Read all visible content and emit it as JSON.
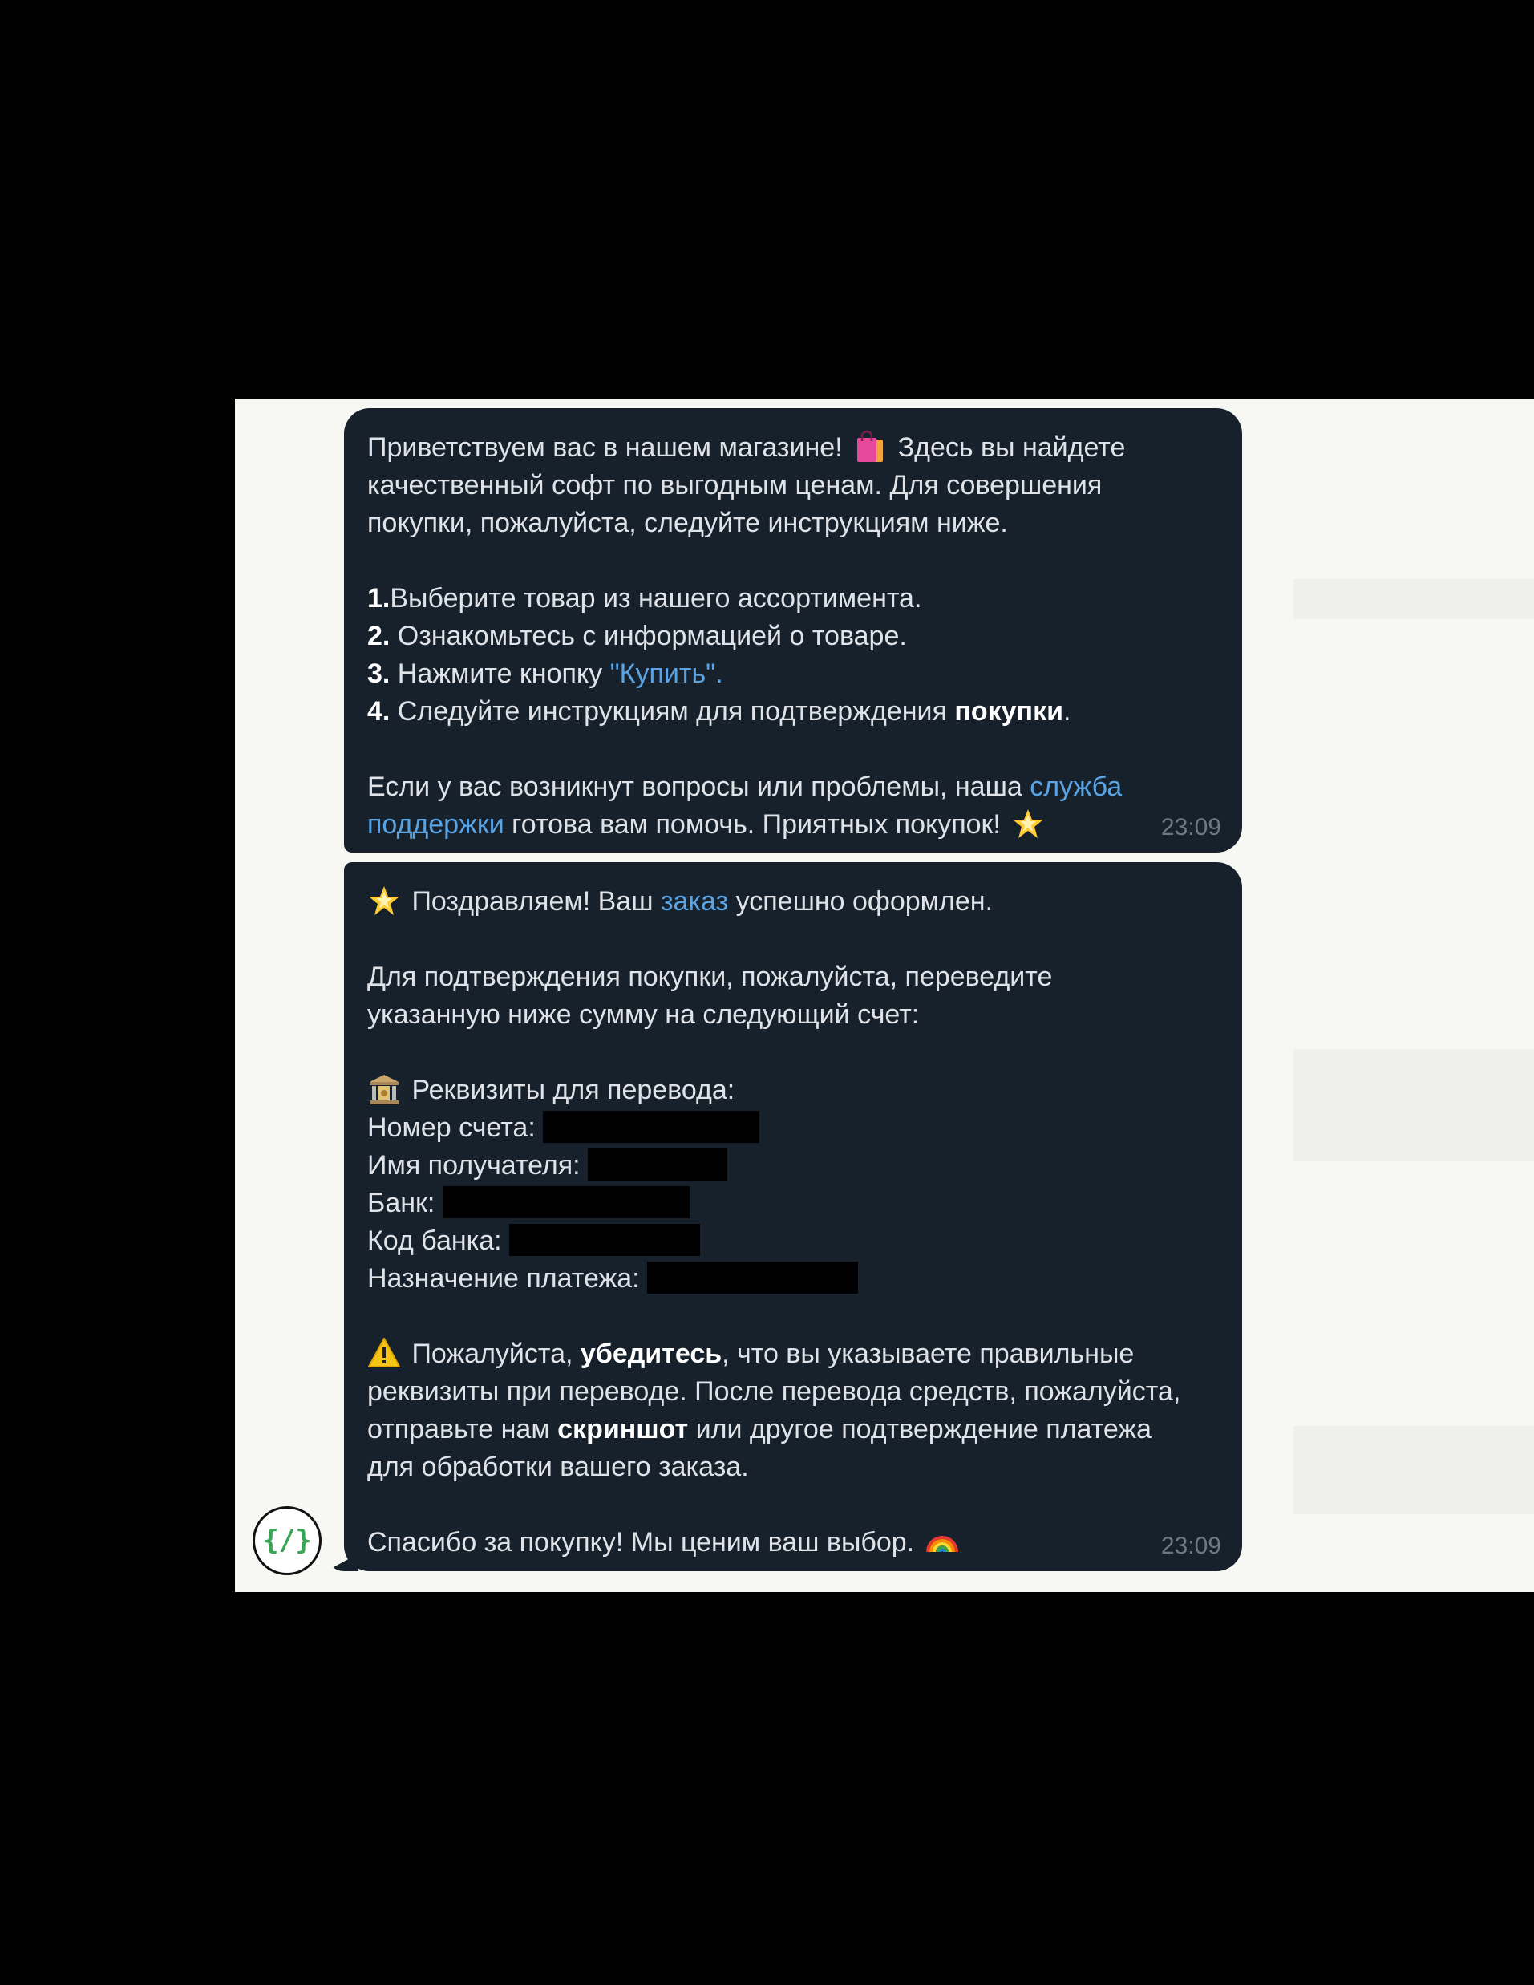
{
  "messages": [
    {
      "lines": {
        "l1a": "Приветствуем вас в нашем магазине!",
        "l1b": "Здесь вы найдете",
        "l2": "качественный софт по выгодным ценам. Для совершения",
        "l3": "покупки, пожалуйста, следуйте инструкциям ниже.",
        "step1_num": "1.",
        "step1_text": "Выберите товар из нашего ассортимента.",
        "step2_num": "2.",
        "step2_text": " Ознакомьтесь с информацией о товаре.",
        "step3_num": "3.",
        "step3_text": " Нажмите кнопку ",
        "step3_link": "\"Купить\".",
        "step4_num": "4.",
        "step4_text": " Следуйте инструкциям для подтверждения ",
        "step4_bold": "покупки",
        "step4_end": ".",
        "help_a": "Если у вас возникнут вопросы или проблемы, наша ",
        "help_link1": "служба",
        "help_link2": "поддержки",
        "help_b": " готова вам помочь. Приятных покупок!"
      },
      "emoji_bag": "shopping-bags",
      "emoji_star": "glowing-star",
      "time": "23:09"
    },
    {
      "lines": {
        "congrats_a": "Поздравляем! Ваш ",
        "congrats_link": "заказ",
        "congrats_b": " успешно оформлен.",
        "confirm1": "Для подтверждения покупки, пожалуйста, переведите",
        "confirm2": "указанную ниже сумму на следующий счет:",
        "req_title": "Реквизиты для перевода:",
        "account": "Номер счета:",
        "recipient": "Имя получателя:",
        "bank": "Банк:",
        "bank_code": "Код банка:",
        "purpose": "Назначение платежа:",
        "warn_a": "Пожалуйста, ",
        "warn_bold": "убедитесь",
        "warn_b": ", что вы указываете правильные",
        "warn2": "реквизиты при переводе. После перевода средств, пожалуйста,",
        "warn3a": "отправьте нам ",
        "warn3_bold": "скриншот",
        "warn3b": " или другое подтверждение платежа",
        "warn4": "для обработки вашего заказа.",
        "thanks": "Спасибо за покупку! Мы ценим ваш выбор."
      },
      "emoji_star": "glowing-star",
      "emoji_bank": "bank",
      "emoji_warning": "warning",
      "emoji_rainbow": "rainbow",
      "time": "23:09"
    }
  ],
  "avatar": {
    "text": "{/}"
  },
  "colors": {
    "bubble": "#17212b",
    "text": "#dfe3e8",
    "link": "#5aa4e4",
    "time": "#6d7883",
    "avatar_glyph": "#3aa655"
  }
}
